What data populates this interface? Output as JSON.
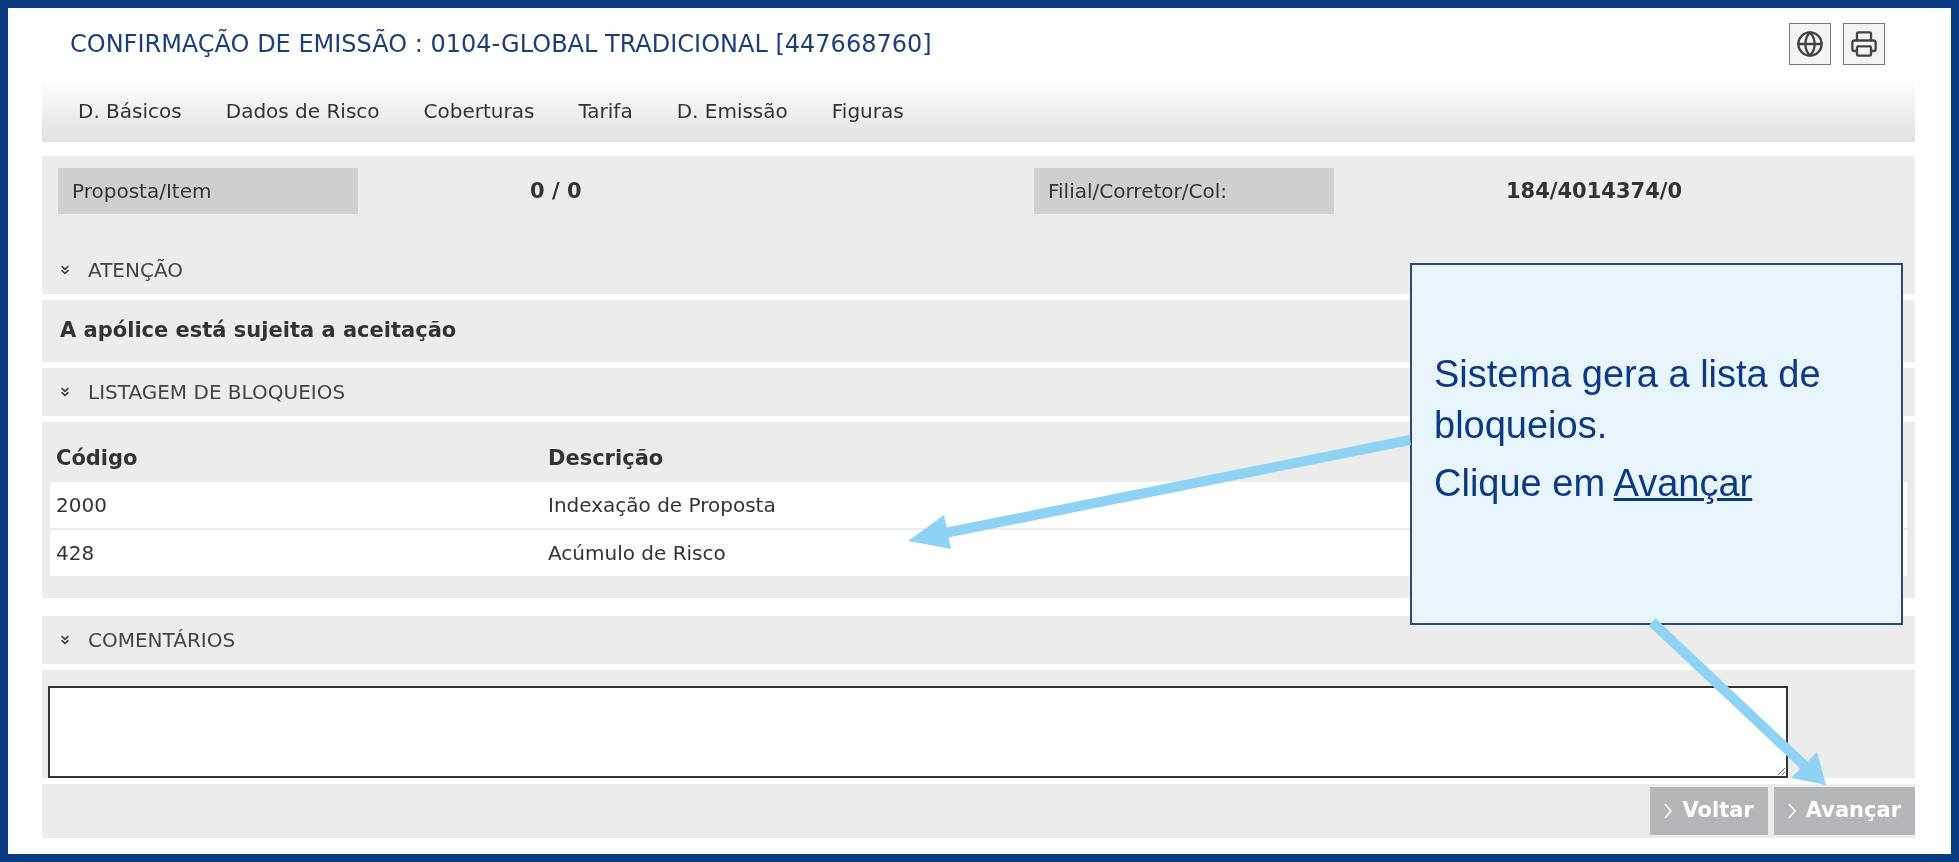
{
  "title": "CONFIRMAÇÃO DE EMISSÃO : 0104-GLOBAL TRADICIONAL [447668760]",
  "tabs": [
    "D. Básicos",
    "Dados de Risco",
    "Coberturas",
    "Tarifa",
    "D. Emissão",
    "Figuras"
  ],
  "info": [
    {
      "label": "Proposta/Item",
      "value": "0 / 0"
    },
    {
      "label": "Filial/Corretor/Col:",
      "value": "184/4014374/0"
    }
  ],
  "attention": {
    "heading": "ATENÇÃO",
    "message": "A apólice está sujeita a aceitação"
  },
  "blocks": {
    "heading": "LISTAGEM DE BLOQUEIOS",
    "columns": [
      "Código",
      "Descrição"
    ],
    "rows": [
      [
        "2000",
        "Indexação de Proposta"
      ],
      [
        "428",
        "Acúmulo de Risco"
      ]
    ]
  },
  "comments": {
    "heading": "COMENTÁRIOS"
  },
  "buttons": [
    "Voltar",
    "Avançar"
  ],
  "callout": {
    "text": "Sistema gera a lista de bloqueios.",
    "prompt": "Clique em",
    "link": "Avançar"
  }
}
